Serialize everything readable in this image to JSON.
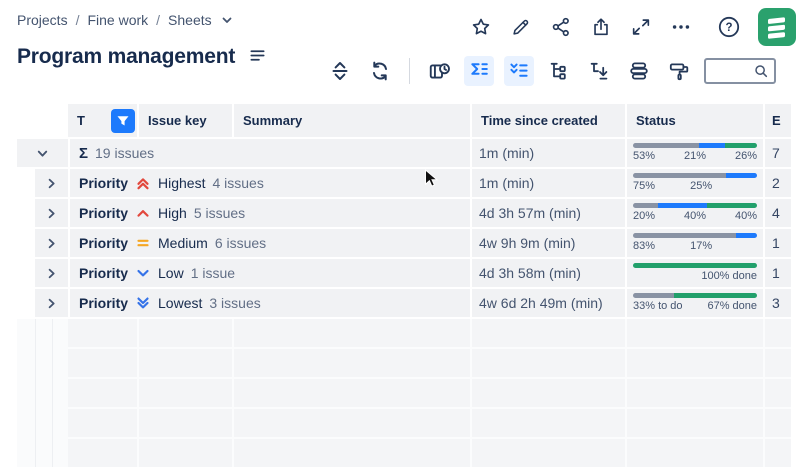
{
  "colors": {
    "accent_blue": "#1d7afc",
    "active_bg": "#e9f2ff",
    "bar_gray": "#8993a4",
    "bar_blue": "#1d7afc",
    "bar_green": "#22a06b",
    "priority_red": "#e2483d",
    "priority_orange": "#f5a623",
    "priority_blue": "#3573e8",
    "logo_green": "#2aa16d"
  },
  "breadcrumb": {
    "items": [
      "Projects",
      "Fine work",
      "Sheets"
    ]
  },
  "page": {
    "title": "Program management"
  },
  "topbar": {
    "icons": [
      "star",
      "pencil",
      "share",
      "export",
      "fullscreen",
      "more",
      "help",
      "structure-logo"
    ]
  },
  "toolbar": {
    "buttons": [
      {
        "name": "expand-collapse",
        "active": false
      },
      {
        "name": "refresh",
        "active": false
      },
      {
        "name": "views",
        "active": false
      },
      {
        "name": "aggregate-sum",
        "active": true
      },
      {
        "name": "group-check",
        "active": true
      },
      {
        "name": "hierarchy",
        "active": false
      },
      {
        "name": "hierarchy-sort",
        "active": false
      },
      {
        "name": "layers",
        "active": false
      },
      {
        "name": "paint-roller",
        "active": false
      }
    ],
    "search": {
      "value": "",
      "placeholder": ""
    }
  },
  "table": {
    "headers": {
      "type": "T",
      "issue_key": "Issue key",
      "summary": "Summary",
      "time_since_created": "Time since created",
      "status": "Status",
      "estimate": "E"
    },
    "rows": [
      {
        "kind": "sum",
        "chevron": "down",
        "sigma": "Σ",
        "count": "19 issues",
        "time": "1m (min)",
        "estimate": "7",
        "bar": [
          {
            "color": "gray",
            "pct": 53,
            "label": "53%"
          },
          {
            "color": "blue",
            "pct": 21,
            "label": "21%"
          },
          {
            "color": "green",
            "pct": 26,
            "label": "26%"
          }
        ]
      },
      {
        "kind": "group",
        "chevron": "right",
        "field": "Priority",
        "priority": "highest",
        "value": "Highest",
        "count": "4 issues",
        "time": "1m (min)",
        "estimate": "2",
        "bar": [
          {
            "color": "gray",
            "pct": 75,
            "label": "75%"
          },
          {
            "color": "blue",
            "pct": 25,
            "label": "25%"
          }
        ]
      },
      {
        "kind": "group",
        "chevron": "right",
        "field": "Priority",
        "priority": "high",
        "value": "High",
        "count": "5 issues",
        "time": "4d 3h 57m (min)",
        "estimate": "4",
        "bar": [
          {
            "color": "gray",
            "pct": 20,
            "label": "20%"
          },
          {
            "color": "blue",
            "pct": 40,
            "label": "40%"
          },
          {
            "color": "green",
            "pct": 40,
            "label": "40%"
          }
        ]
      },
      {
        "kind": "group",
        "chevron": "right",
        "field": "Priority",
        "priority": "medium",
        "value": "Medium",
        "count": "6 issues",
        "time": "4w 9h 9m (min)",
        "estimate": "1",
        "bar": [
          {
            "color": "gray",
            "pct": 83,
            "label": "83%"
          },
          {
            "color": "blue",
            "pct": 17,
            "label": "17%"
          }
        ]
      },
      {
        "kind": "group",
        "chevron": "right",
        "field": "Priority",
        "priority": "low",
        "value": "Low",
        "count": "1 issue",
        "time": "4d 3h 58m (min)",
        "estimate": "1",
        "bar": [
          {
            "color": "green",
            "pct": 100,
            "label": "100% done"
          }
        ]
      },
      {
        "kind": "group",
        "chevron": "right",
        "field": "Priority",
        "priority": "lowest",
        "value": "Lowest",
        "count": "3 issues",
        "time": "4w 6d 2h 49m (min)",
        "estimate": "3",
        "bar": [
          {
            "color": "gray",
            "pct": 33,
            "label": "33% to do"
          },
          {
            "color": "green",
            "pct": 67,
            "label": "67% done"
          }
        ]
      }
    ]
  }
}
